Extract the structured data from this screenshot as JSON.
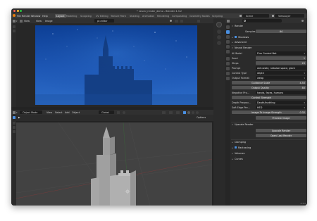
{
  "window": {
    "title": "* neural_render_demo - Blender 4.3.2"
  },
  "menubar": {
    "items": [
      "File",
      "Render",
      "Window",
      "Help"
    ],
    "workspace_tabs": [
      "Layout",
      "Modeling",
      "Sculpting",
      "UV Editing",
      "Texture Paint",
      "Shading",
      "Animation",
      "Rendering",
      "Compositing",
      "Geometry Nodes",
      "Scripting"
    ],
    "active_tab": "Layout",
    "scene": "Scene",
    "view_layer": "ViewLayer"
  },
  "image_editor": {
    "view_label": "View",
    "view_menu": "View",
    "image_menu": "Image",
    "image_name": "pt.editor"
  },
  "viewport": {
    "mode": "Object Mode",
    "menus": [
      "View",
      "Select",
      "Add",
      "Object"
    ],
    "transform": "Global",
    "options_label": "Options"
  },
  "properties": {
    "samples_label": "Samples",
    "samples_value": "64",
    "sections_top": [
      {
        "label": "Render",
        "expanded": true
      },
      {
        "label": "Shadows",
        "expanded": false,
        "checked": true
      },
      {
        "label": "Advanced",
        "expanded": false
      }
    ],
    "neural_render": {
      "header": "Neural Render",
      "ai_model_label": "AI Model",
      "ai_model_value": "Flux Control Net",
      "seed_label": "Seed",
      "seed_value": "1",
      "steps_label": "Steps",
      "steps_value": "20",
      "prompt_label": "Prompt",
      "prompt_value": "old castle, nebulae space, glare",
      "control_type_label": "Control Type",
      "control_type_value": "depth",
      "output_format_label": "Output Format",
      "output_format_value": "webp",
      "guidance_scale_label": "Guidance Scale",
      "guidance_scale_value": "4.50",
      "output_quality_label": "Output Quality",
      "output_quality_value": "80",
      "negative_prompt_label": "Negative Pro...",
      "negative_prompt_value": "hands, faces, humans",
      "control_strength_label": "Control Strength",
      "control_strength_value": "",
      "depth_preproc_label": "Depth Preproc...",
      "depth_preproc_value": "DepthAnything",
      "soft_edge_label": "Soft Edge Pre...",
      "soft_edge_value": "HED",
      "image_strength_label": "Image To Image Strength",
      "image_strength_value": "0.32",
      "preview_button": "Preview Image"
    },
    "upscale": {
      "header": "Upscale Render",
      "upscale_button": "Upscale Render",
      "open_last_button": "Open Last Render"
    },
    "sections_bottom": [
      {
        "label": "Clamping"
      },
      {
        "label": "Raytracing",
        "checked": true
      },
      {
        "label": "Volumes"
      },
      {
        "label": "Curves"
      }
    ],
    "version": "4.3.2"
  },
  "colors": {
    "accent": "#4a90e2",
    "panel_bg": "#2b2b2b",
    "field_bg": "#545454",
    "sky_top": "#0d3f95",
    "sky_bottom": "#2c6bc6"
  }
}
